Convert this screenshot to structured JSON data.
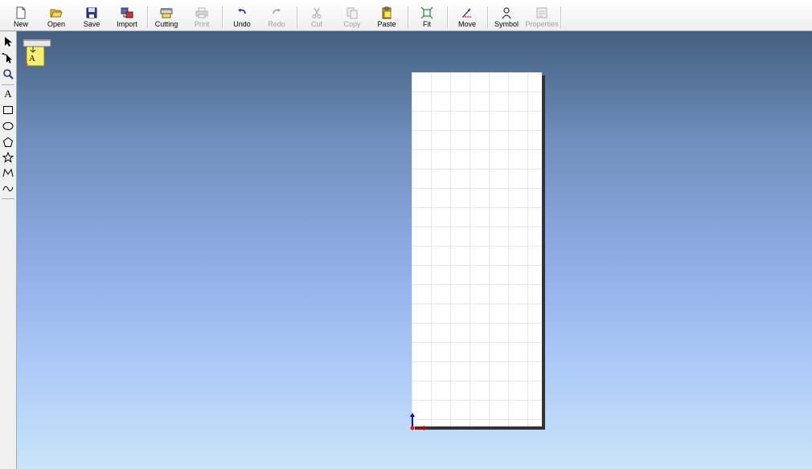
{
  "toolbar": {
    "new": "New",
    "open": "Open",
    "save": "Save",
    "import": "Import",
    "cutting": "Cutting",
    "print": "Print",
    "undo": "Undo",
    "redo": "Redo",
    "cut": "Cut",
    "copy": "Copy",
    "paste": "Paste",
    "fit": "Fit",
    "move": "Move",
    "symbol": "Symbol",
    "properties": "Properties"
  },
  "palette": {
    "text_tool_glyph": "A"
  },
  "canvas": {
    "plotter_label": "A"
  },
  "colors": {
    "canvas_top": "#44607f",
    "canvas_bottom": "#cae4f8",
    "sheet": "#ffffff",
    "grid": "#e6e6e6",
    "axis_x": "#c00000",
    "axis_y": "#0000c0"
  }
}
